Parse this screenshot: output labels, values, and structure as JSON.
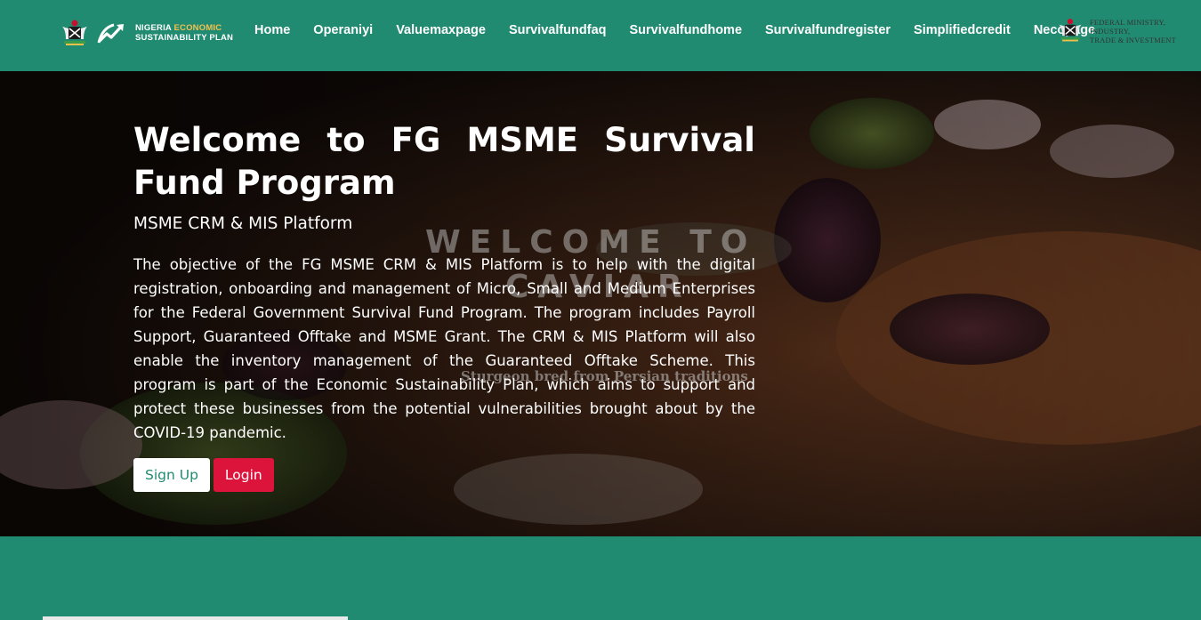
{
  "header": {
    "esp_logo": {
      "line1_prefix": "NIGERIA ",
      "line1_highlight": "ECONOMIC",
      "line2": "SUSTAINABILITY PLAN"
    },
    "nav_links": [
      "Home",
      "Operaniyi",
      "Valuemaxpage",
      "Survivalfundfaq",
      "Survivalfundhome",
      "Survivalfundregister",
      "Simplifiedcredit",
      "Necopage"
    ],
    "ministry_logo": {
      "line1": "FEDERAL MINISTRY, INDUSTRY,",
      "line2": "TRADE & INVESTMENT"
    }
  },
  "hero": {
    "title": "Welcome to FG MSME Survival Fund Program",
    "subtitle": "MSME CRM & MIS Platform",
    "description": "The objective of the FG MSME CRM & MIS Platform is to help with the digital registration, onboarding and management of Micro, Small and Medium Enterprises for the Federal Government Survival Fund Program. The program includes Payroll Support, Guaranteed Offtake and MSME Grant. The CRM & MIS Platform will also enable the inventory management of the Guaranteed Offtake Scheme. This program is part of the Economic Sustainability Plan, which aims to support and protect these businesses from the potential vulnerabilities brought about by the COVID-19 pandemic.",
    "background_text": {
      "line1": "WELCOME TO",
      "line2": "CAVIAR",
      "caption": "Sturgeon bred from Persian traditions"
    },
    "buttons": {
      "signup": "Sign Up",
      "login": "Login"
    }
  },
  "colors": {
    "brand_teal": "#218b72",
    "login_red": "#dc143c",
    "highlight_gold": "#f2c14e"
  }
}
